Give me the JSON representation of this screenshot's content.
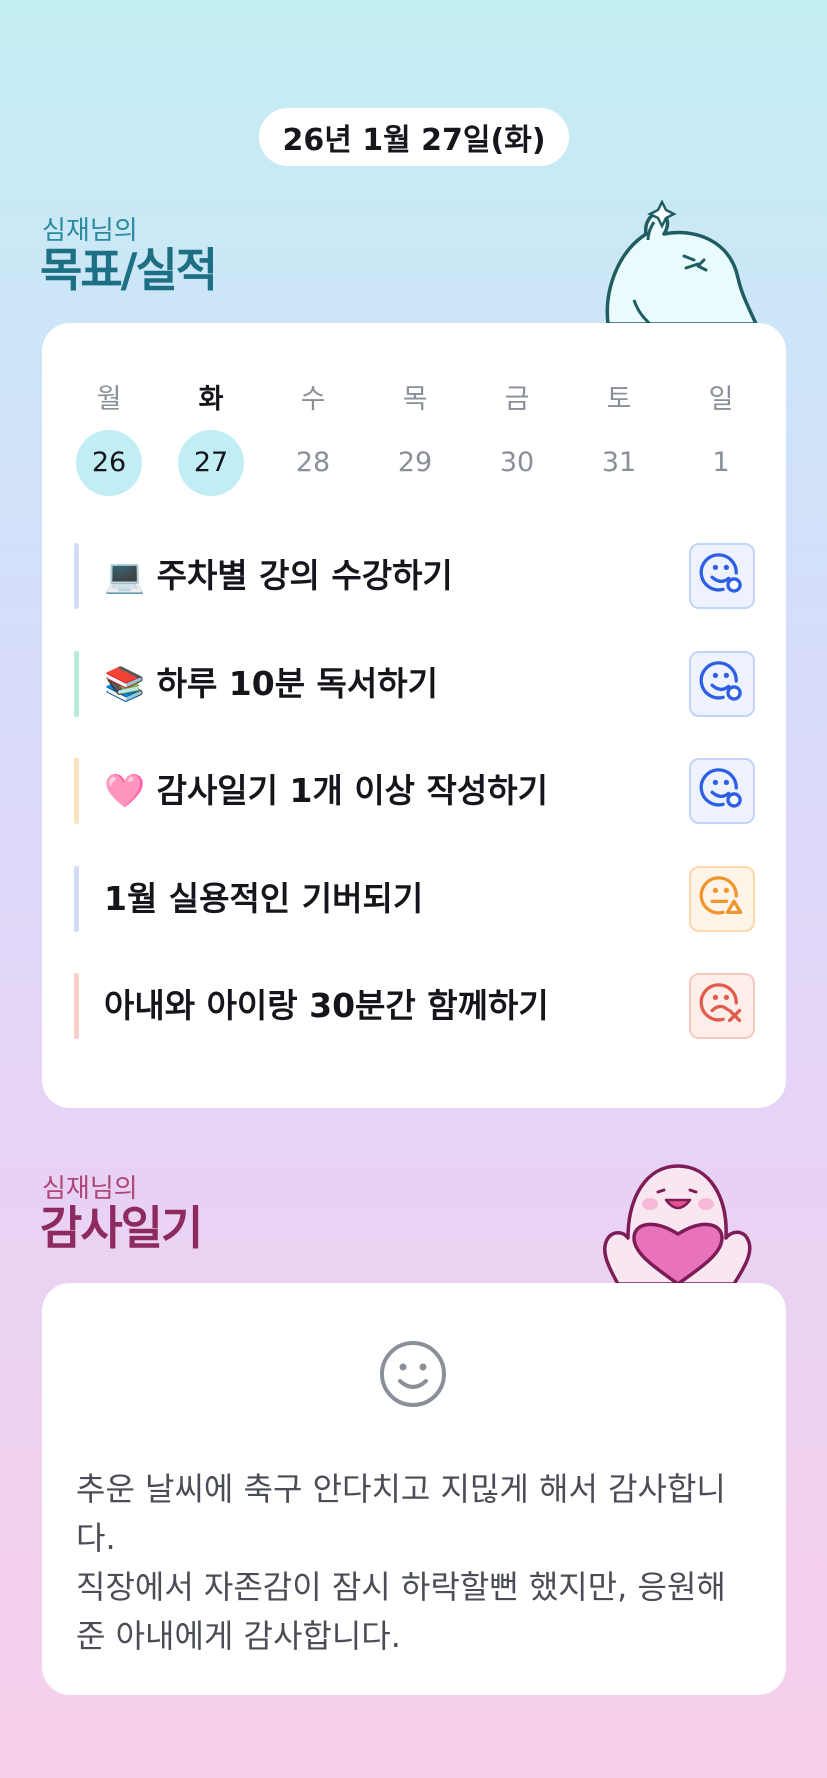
{
  "header": {
    "date": "26년 1월 27일(화)"
  },
  "goals_section": {
    "subtitle": "심재님의",
    "title": "목표/실적"
  },
  "week": {
    "days": [
      {
        "weekday": "월",
        "date": "26"
      },
      {
        "weekday": "화",
        "date": "27"
      },
      {
        "weekday": "수",
        "date": "28"
      },
      {
        "weekday": "목",
        "date": "29"
      },
      {
        "weekday": "금",
        "date": "30"
      },
      {
        "weekday": "토",
        "date": "31"
      },
      {
        "weekday": "일",
        "date": "1"
      }
    ],
    "today_weekday": "화",
    "filled_dates": [
      "26",
      "27"
    ]
  },
  "goals": [
    {
      "label": "💻 주차별 강의 수강하기",
      "status": "done",
      "bar_color": "#d3dcf4"
    },
    {
      "label": "📚 하루 10분 독서하기",
      "status": "done",
      "bar_color": "#b7ecd8"
    },
    {
      "label": "🩷 감사일기 1개 이상 작성하기",
      "status": "done",
      "bar_color": "#fde2c2"
    },
    {
      "label": "1월 실용적인 기버되기",
      "status": "partial",
      "bar_color": "#d3dcf4"
    },
    {
      "label": "아내와 아이랑 30분간 함께하기",
      "status": "fail",
      "bar_color": "#fbd0cc"
    }
  ],
  "gratitude_section": {
    "subtitle": "심재님의",
    "title": "감사일기"
  },
  "gratitude": {
    "icon": "smile-icon",
    "text": "추운 날씨에 축구 안다치고 지믾게 해서 감사합니\n다.\n직장에서 자존감이 잠시 하락할뻔 했지만, 응원해\n준 아내에게 감사합니다."
  },
  "colors": {
    "accent_teal": "#1d6f84",
    "accent_plum": "#8e2a62",
    "status_done": "#2c5fe6",
    "status_partial": "#f0952e",
    "status_fail": "#e35b4a"
  }
}
